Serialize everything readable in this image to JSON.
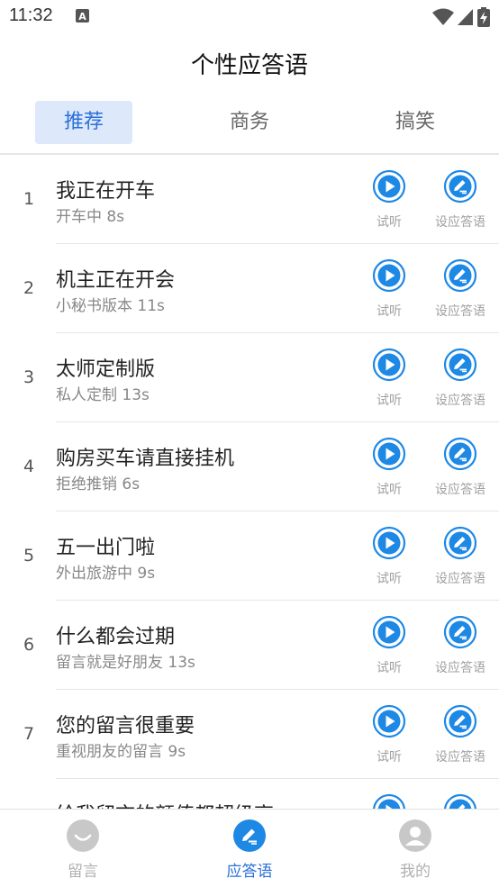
{
  "status_bar": {
    "time": "11:32",
    "icons": [
      "notification-a-icon",
      "wifi-icon",
      "signal-icon",
      "battery-charging-icon"
    ]
  },
  "header": {
    "title": "个性应答语"
  },
  "tabs": [
    {
      "label": "推荐",
      "active": true
    },
    {
      "label": "商务",
      "active": false
    },
    {
      "label": "搞笑",
      "active": false
    }
  ],
  "list": {
    "play_label": "试听",
    "set_label": "设应答语",
    "items": [
      {
        "num": "1",
        "title": "我正在开车",
        "subtitle": "开车中 8s"
      },
      {
        "num": "2",
        "title": "机主正在开会",
        "subtitle": "小秘书版本 11s"
      },
      {
        "num": "3",
        "title": "太师定制版",
        "subtitle": "私人定制 13s"
      },
      {
        "num": "4",
        "title": "购房买车请直接挂机",
        "subtitle": "拒绝推销 6s"
      },
      {
        "num": "5",
        "title": "五一出门啦",
        "subtitle": "外出旅游中 9s"
      },
      {
        "num": "6",
        "title": "什么都会过期",
        "subtitle": "留言就是好朋友 13s"
      },
      {
        "num": "7",
        "title": "您的留言很重要",
        "subtitle": "重视朋友的留言 9s"
      },
      {
        "num": "",
        "title": "给我留言的颜值都超级高",
        "subtitle": ""
      }
    ]
  },
  "bottom_nav": [
    {
      "label": "留言",
      "icon": "smile-face-icon",
      "active": false
    },
    {
      "label": "应答语",
      "icon": "edit-pen-icon",
      "active": true
    },
    {
      "label": "我的",
      "icon": "user-profile-icon",
      "active": false
    }
  ],
  "colors": {
    "accent": "#2a70d8",
    "icon_blue": "#1e88e5",
    "tab_active_bg": "#dde8fb",
    "inactive_icon": "#c8c8c8"
  }
}
